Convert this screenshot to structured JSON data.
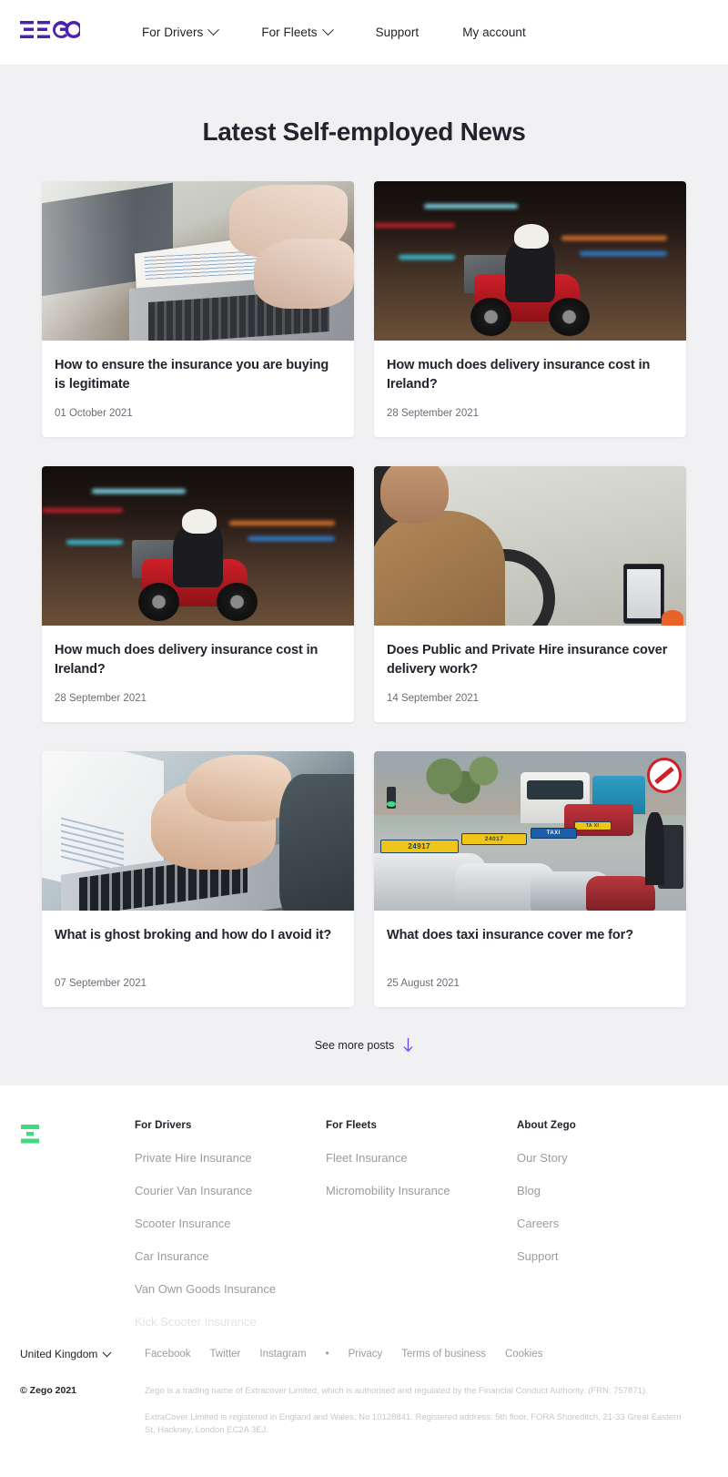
{
  "header": {
    "logo_text": "ZEGO",
    "nav": [
      {
        "label": "For Drivers",
        "has_chevron": true,
        "icon": "chevron-down-icon"
      },
      {
        "label": "For Fleets",
        "has_chevron": true,
        "icon": "chevron-down-icon"
      },
      {
        "label": "Support",
        "has_chevron": false,
        "icon": ""
      },
      {
        "label": "My account",
        "has_chevron": false,
        "icon": ""
      }
    ]
  },
  "main": {
    "title": "Latest Self-employed News",
    "posts": [
      {
        "title": "How to ensure the insurance you are buying is legitimate",
        "date": "01 October 2021",
        "image": "desk-notebook-laptop-photo"
      },
      {
        "title": "How much does delivery insurance cost in Ireland?",
        "date": "28 September 2021",
        "image": "delivery-scooter-night-photo"
      },
      {
        "title": "How much does delivery insurance cost in Ireland?",
        "date": "28 September 2021",
        "image": "delivery-scooter-night-photo"
      },
      {
        "title": "Does Public and Private Hire insurance cover delivery work?",
        "date": "14 September 2021",
        "image": "driver-car-interior-photo"
      },
      {
        "title": "What is ghost broking and how do I avoid it?",
        "date": "07 September 2021",
        "image": "hands-typing-laptop-photo"
      },
      {
        "title": "What does taxi insurance cover me for?",
        "date": "25 August 2021",
        "image": "taxi-rank-street-photo"
      }
    ],
    "see_more_label": "See more posts",
    "see_more_icon": "arrow-down-icon"
  },
  "footer": {
    "brand_mark": "Z",
    "columns": [
      {
        "title": "For Drivers",
        "links": [
          {
            "label": "Private Hire Insurance",
            "faded": false
          },
          {
            "label": "Courier Van Insurance",
            "faded": false
          },
          {
            "label": "Scooter Insurance",
            "faded": false
          },
          {
            "label": "Car Insurance",
            "faded": false
          },
          {
            "label": "Van Own Goods Insurance",
            "faded": false
          },
          {
            "label": "Kick Scooter Insurance",
            "faded": true
          }
        ]
      },
      {
        "title": "For Fleets",
        "links": [
          {
            "label": "Fleet Insurance",
            "faded": false
          },
          {
            "label": "Micromobility Insurance",
            "faded": false
          }
        ]
      },
      {
        "title": "About Zego",
        "links": [
          {
            "label": "Our Story",
            "faded": false
          },
          {
            "label": "Blog",
            "faded": false
          },
          {
            "label": "Careers",
            "faded": false
          },
          {
            "label": "Support",
            "faded": false
          }
        ]
      }
    ],
    "country": {
      "label": "United Kingdom",
      "icon": "chevron-down-icon"
    },
    "bottom_links": [
      "Facebook",
      "Twitter",
      "Instagram",
      "•",
      "Privacy",
      "Terms of business",
      "Cookies"
    ],
    "copyright": "© Zego 2021",
    "legal": [
      "Zego is a trading name of Extracover Limited, which is authorised and regulated by the Financial Conduct Authority. (FRN: 757871).",
      "ExtraCover Limited is registered in England and Wales, No 10128841. Registered address: 5th floor, FORA Shoreditch, 21-33 Great Eastern St, Hackney, London EC2A 3EJ."
    ]
  },
  "colors": {
    "brand_purple": "#4c21ad",
    "brand_green": "#3ddc84",
    "text_dark": "#24222c",
    "text_muted": "#9b9ba3",
    "page_bg": "#f1f1f3"
  },
  "taxi_signs": [
    "24917",
    "TAXI",
    "24017",
    "TA XI"
  ]
}
